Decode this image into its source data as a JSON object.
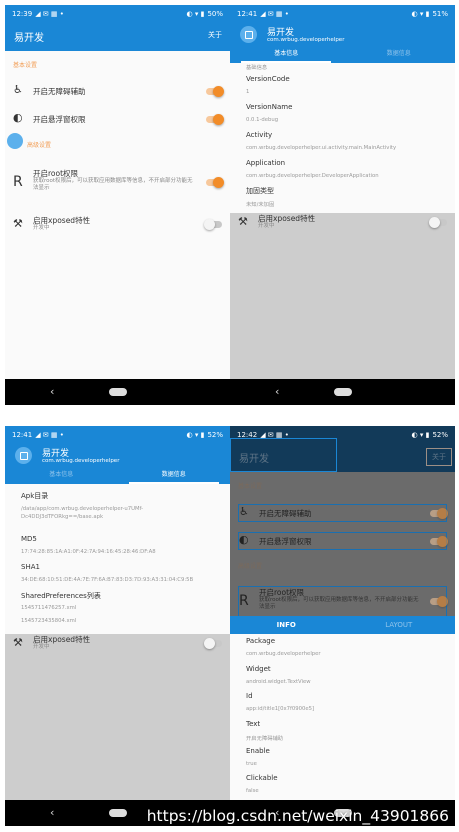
{
  "colors": {
    "primary": "#1a87d6",
    "accent": "#f28c28",
    "section": "#f2a05a"
  },
  "q1": {
    "status": {
      "time": "12:39",
      "battery": "50%"
    },
    "toolbar": {
      "title": "易开发",
      "about": "关于"
    },
    "section_basic": "基本设置",
    "a11y": "开启无障碍辅助",
    "float": "开启悬浮窗权限",
    "section_adv": "高级设置",
    "root": {
      "title": "开启root权限",
      "sub": "获取root权限后，可以获取应用数据库等信息，不开启部分功能无法显示"
    },
    "xposed": {
      "title": "启用xposed特性",
      "sub": "开发中"
    }
  },
  "q2": {
    "status": {
      "time": "12:41",
      "battery": "51%"
    },
    "header": {
      "title": "易开发",
      "sub": "com.wrbug.developerhelper"
    },
    "tabs": [
      "基本信息",
      "数据信息"
    ],
    "top_cut": "基础信息",
    "items": [
      {
        "k": "VersionCode",
        "v": "1"
      },
      {
        "k": "VersionName",
        "v": "0.0.1-debug"
      },
      {
        "k": "Activity",
        "v": "com.wrbug.developerhelper.ui.activity.main.MainActivity"
      },
      {
        "k": "Application",
        "v": "com.wrbug.developerhelper.DeveloperApplication"
      },
      {
        "k": "加固类型",
        "v": "未知/未加固"
      }
    ],
    "xposed": {
      "title": "启用xposed特性",
      "sub": "开发中"
    }
  },
  "q3": {
    "status": {
      "time": "12:41",
      "battery": "52%"
    },
    "header": {
      "title": "易开发",
      "sub": "com.wrbug.developerhelper"
    },
    "tabs": [
      "基本信息",
      "数据信息"
    ],
    "items": [
      {
        "k": "Apk目录",
        "v": "/data/app/com.wrbug.developerhelper-u7UMf-Dc4DDJ3dTFORkg==/base.apk"
      },
      {
        "k": "MD5",
        "v": "17:74:28:85:1A:A1:0F:42:7A:94:16:45:28:46:DF:A8"
      },
      {
        "k": "SHA1",
        "v": "34:DE:68:10:51:DE:4A:7E:7F:6A:B7:83:D3:7D:93:A3:31:04:C9:5B"
      },
      {
        "k": "SharedPreferences列表",
        "v": "1545711476257.xml"
      }
    ],
    "extra": "1545723435804.xml",
    "xposed": {
      "title": "启用xposed特性",
      "sub": "开发中"
    }
  },
  "q4": {
    "status": {
      "time": "12:42",
      "battery": "52%"
    },
    "toolbar": {
      "title": "易开发",
      "about": "关于"
    },
    "section_basic": "基本设置",
    "a11y": "开启无障碍辅助",
    "float": "开启悬浮窗权限",
    "section_adv": "高级设置",
    "root": {
      "title": "开启root权限",
      "sub": "获取root权限后，可以获取应用数据库等信息，不开启部分功能无法显示"
    },
    "tabs": [
      "INFO",
      "LAYOUT"
    ],
    "items": [
      {
        "k": "Package",
        "v": "com.wrbug.developerhelper"
      },
      {
        "k": "Widget",
        "v": "android.widget.TextView"
      },
      {
        "k": "Id",
        "v": "app:id/title1[0x7f0900e5]"
      },
      {
        "k": "Text",
        "v": "开启无障碍辅助"
      },
      {
        "k": "Enable",
        "v": "true"
      },
      {
        "k": "Clickable",
        "v": "false"
      }
    ]
  },
  "watermark": "https://blog.csdn.net/weixin_43901866"
}
